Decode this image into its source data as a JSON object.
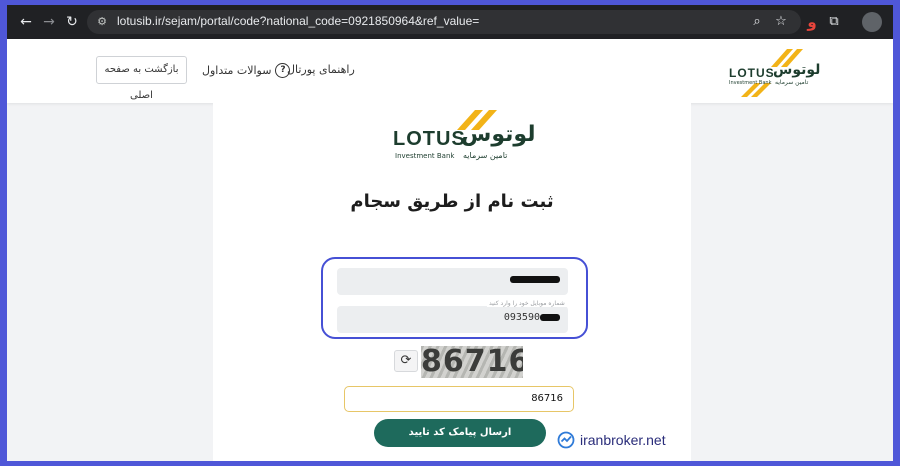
{
  "browser": {
    "url": "lotusib.ir/sejam/portal/code?national_code=0921850964&ref_value=",
    "icons": [
      "back-arrow-icon",
      "forward-arrow-icon",
      "reload-icon",
      "site-settings-icon",
      "zoom-icon",
      "star-icon",
      "extension-icon",
      "puzzle-icon",
      "profile-icon"
    ]
  },
  "header": {
    "back_label": "بازگشت به صفحه اصلی",
    "faq_label": "سوالات متداول",
    "guide_label": "راهنمای پورتال"
  },
  "logo": {
    "latin": "LOTUS",
    "farsi": "لوتوس",
    "sub_en": "Investment Bank",
    "sub_fa": "تامین سرمایه",
    "colors": {
      "accent": "#f2b318",
      "text": "#1d3d2e"
    }
  },
  "form": {
    "title": "ثبت نام از طریق سجام",
    "national_code_value": "",
    "mobile_placeholder": "شماره موبایل خود را وارد کنید",
    "mobile_value_prefix": "093590",
    "captcha_text": "86716",
    "captcha_input_value": "86716",
    "submit_label": "ارسال پیامک کد تایید"
  },
  "watermark": {
    "text": "iranbroker.net"
  },
  "colors": {
    "highlight": "#4650d5",
    "button": "#1e6a5c",
    "frame": "#4f57d8"
  }
}
